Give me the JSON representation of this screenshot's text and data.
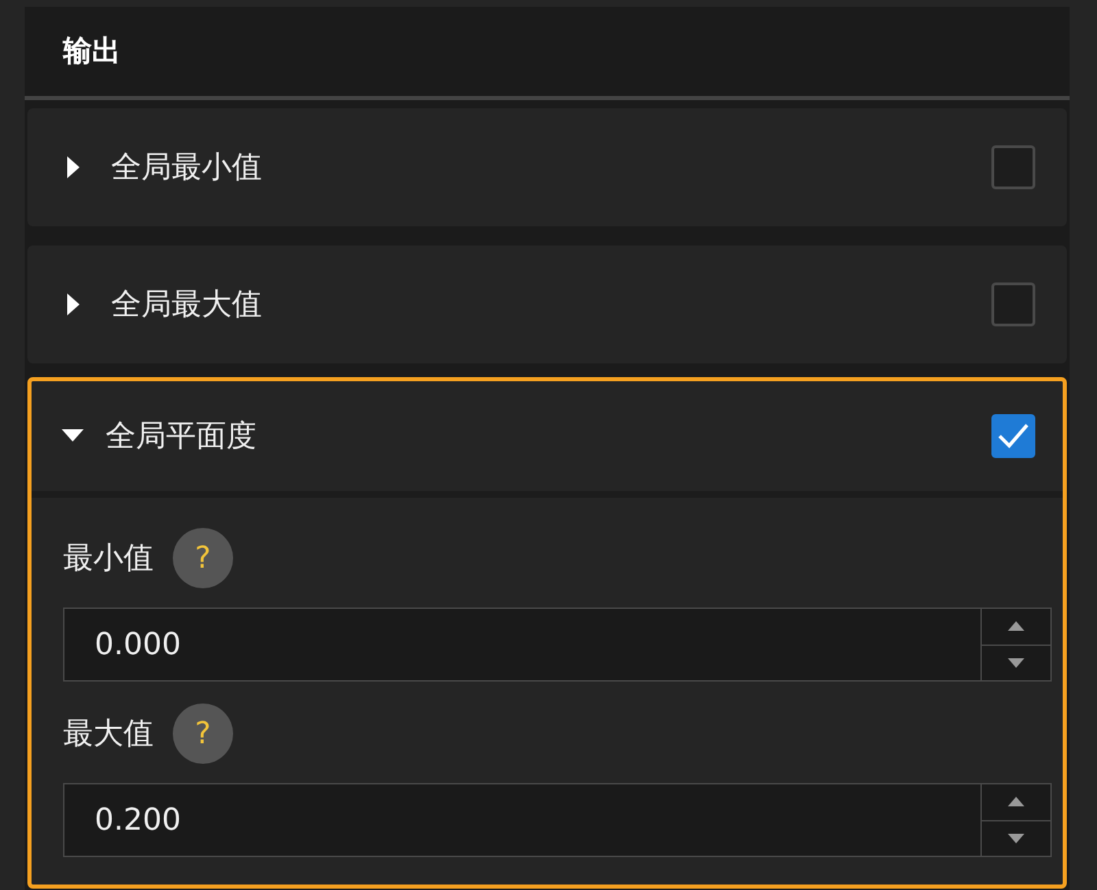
{
  "panel": {
    "title": "输出"
  },
  "sections": [
    {
      "label": "全局最小值",
      "expanded": false,
      "checked": false,
      "highlighted": false
    },
    {
      "label": "全局最大值",
      "expanded": false,
      "checked": false,
      "highlighted": false
    },
    {
      "label": "全局平面度",
      "expanded": true,
      "checked": true,
      "highlighted": true,
      "fields": [
        {
          "label": "最小值",
          "help": "?",
          "value": "0.000"
        },
        {
          "label": "最大值",
          "help": "?",
          "value": "0.200"
        }
      ]
    }
  ]
}
